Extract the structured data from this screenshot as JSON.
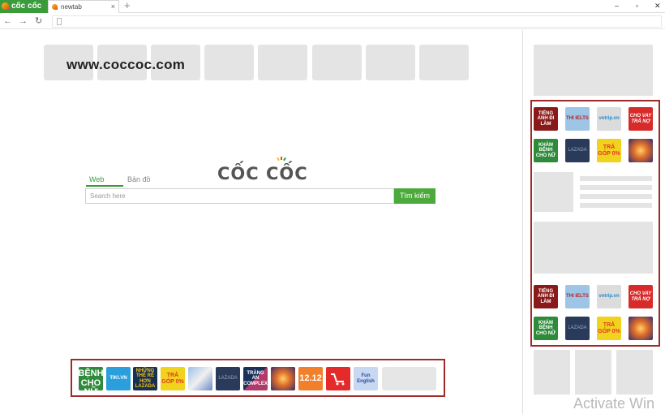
{
  "browser": {
    "brand_tab_label": "cốc cốc",
    "tab_title": "newtab",
    "tab_close": "×",
    "new_tab": "+",
    "win_min": "–",
    "win_max": "▫",
    "win_close": "✕",
    "nav_back": "←",
    "nav_forward": "→",
    "nav_reload": "↻"
  },
  "speed_dial": {
    "site_url": "www.coccoc.com"
  },
  "search": {
    "logo_text": "CỐC CỐC",
    "tab_web": "Web",
    "tab_map": "Bản đồ",
    "placeholder": "Search here",
    "button_label": "Tìm kiếm"
  },
  "ad_icons": {
    "english": "TIẾNG ANH ĐI LÀM",
    "ielts": "THI IELTS",
    "vntrip": "vntrip.vn",
    "chovay": "CHO VAY TRẢ NỢ",
    "khambenh": "KHÁM BỆNH CHO NỮ",
    "lazada": "LAZADA",
    "tragop": "TRẢ GÓP 0%",
    "tiki": "TIKI.VN",
    "nhungthe": "NHỮNG THẺ RẺ HƠN LAZADA",
    "trangan": "TRÀNG AN COMPLEX",
    "sale1212": "12.12",
    "funenglish": "Fun English"
  },
  "overlay": {
    "watermark": "Activate Win"
  },
  "colors": {
    "brand_green": "#3a9b3a",
    "highlight_border": "#a02a2a",
    "placeholder_grey": "#e4e4e4"
  }
}
